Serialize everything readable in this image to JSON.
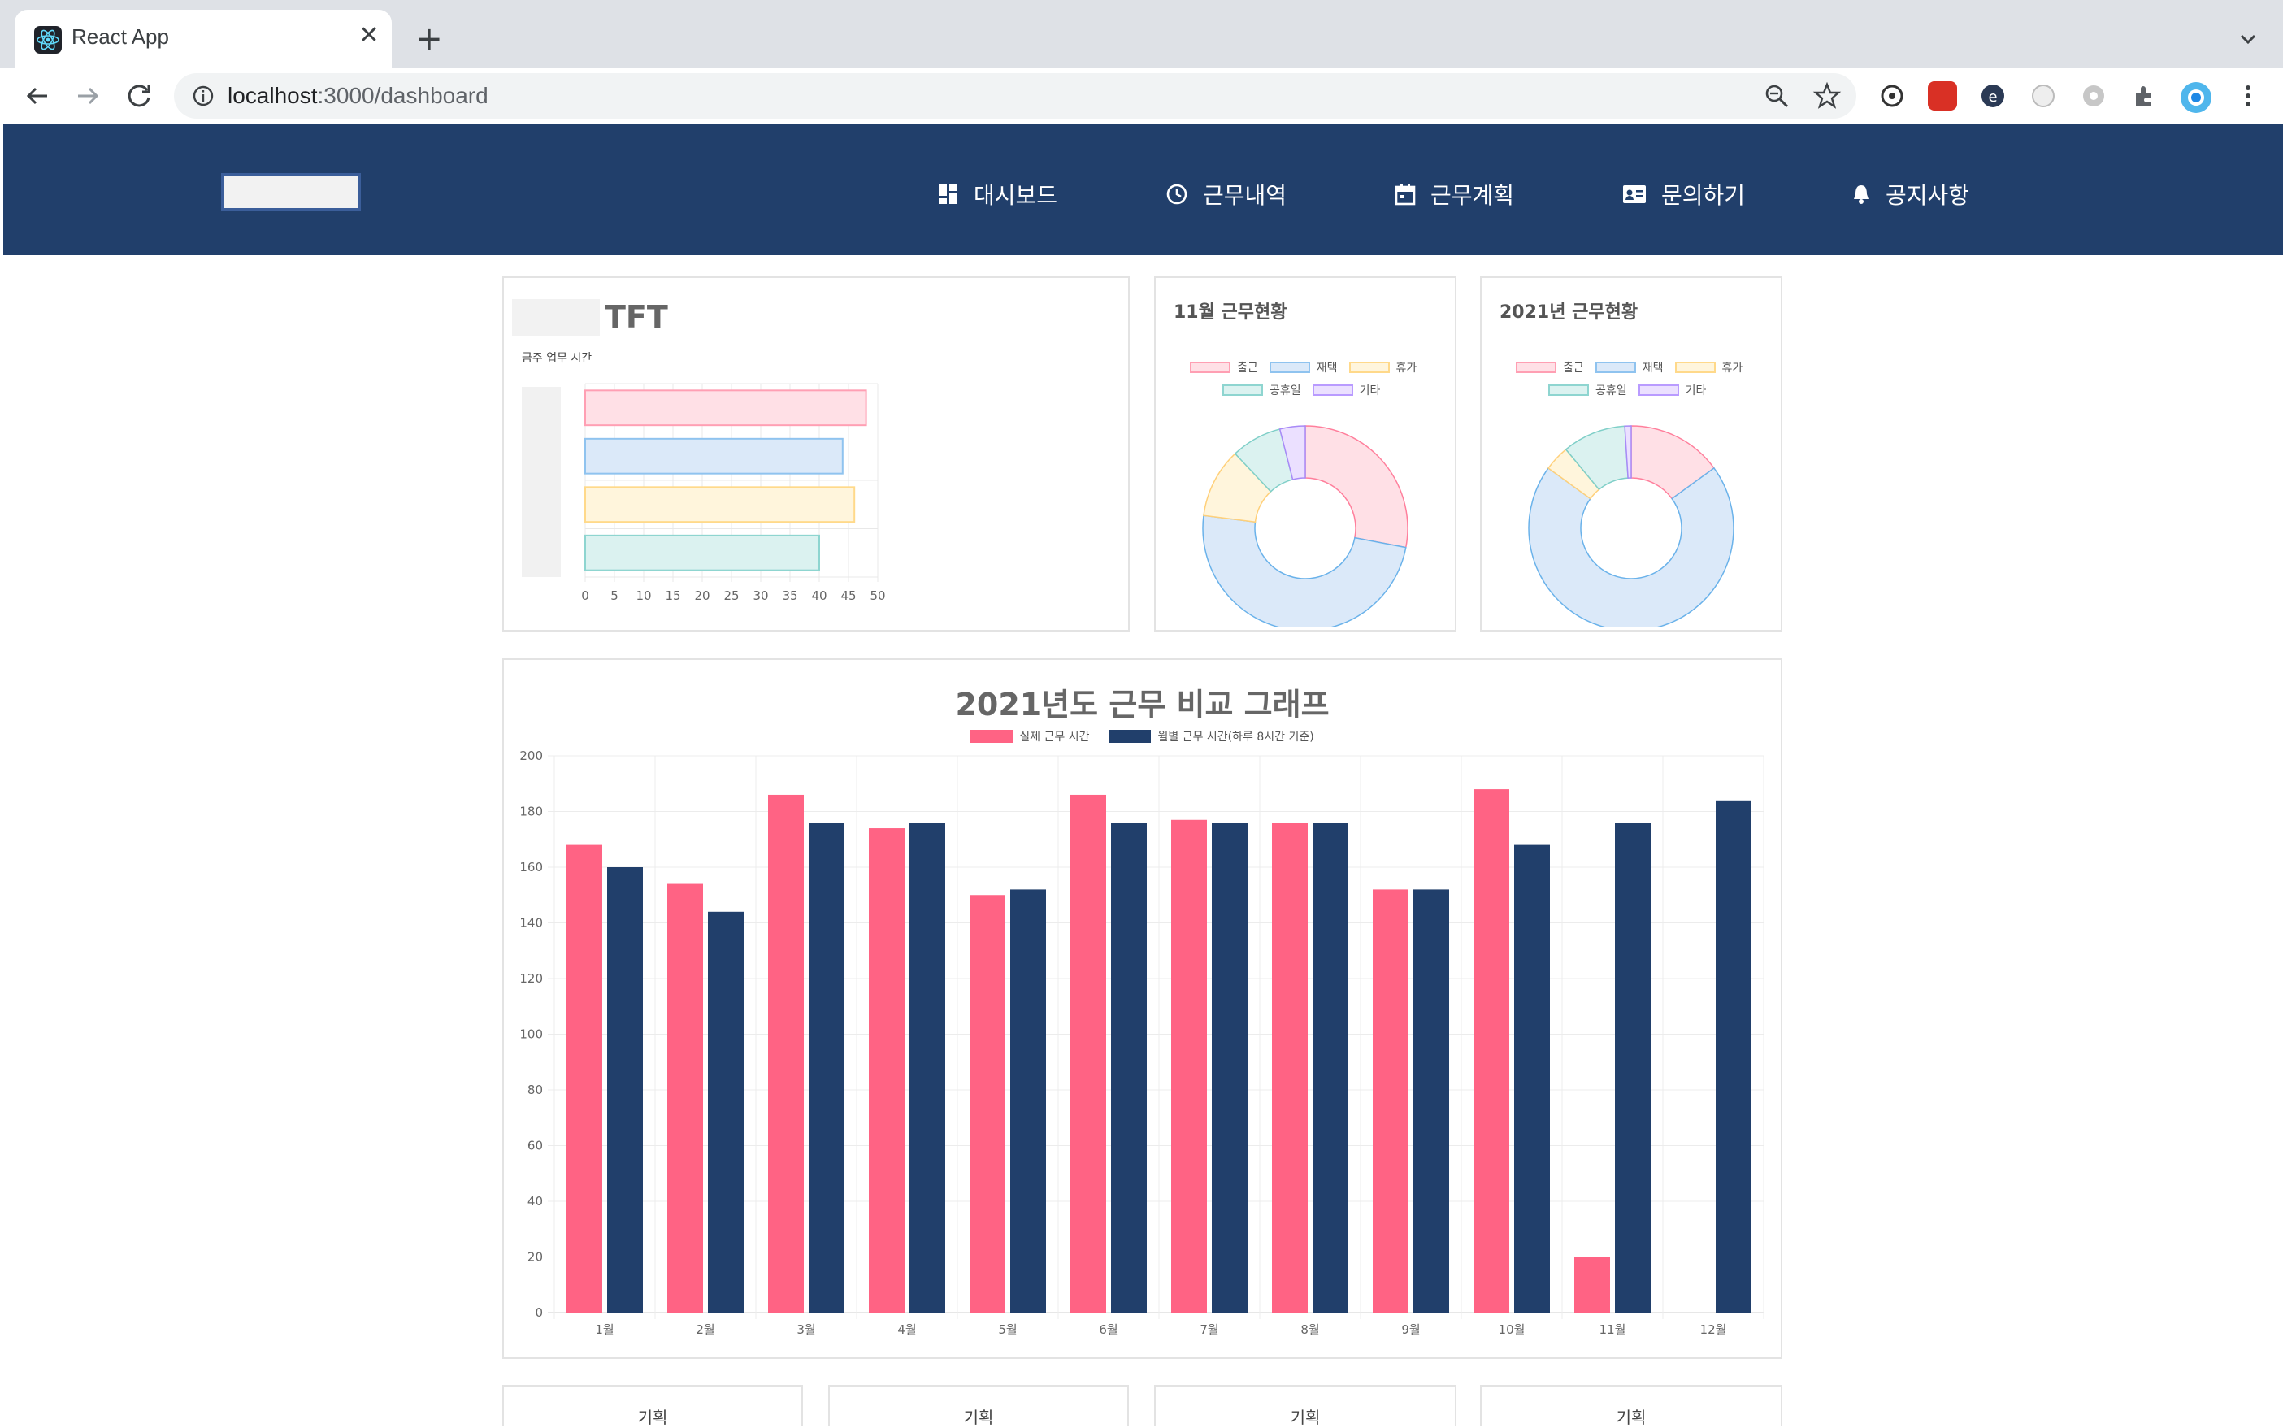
{
  "browser": {
    "tab_title": "React App",
    "url_host": "localhost",
    "url_path": ":3000/dashboard"
  },
  "nav": {
    "items": [
      {
        "label": "대시보드",
        "icon": "dashboard-icon"
      },
      {
        "label": "근무내역",
        "icon": "clock-icon"
      },
      {
        "label": "근무계획",
        "icon": "calendar-icon"
      },
      {
        "label": "문의하기",
        "icon": "contact-card-icon"
      },
      {
        "label": "공지사항",
        "icon": "bell-icon"
      }
    ]
  },
  "week_card": {
    "title": "TFT",
    "subtitle": "금주 업무 시간"
  },
  "month_card": {
    "title": "11월 근무현황"
  },
  "year_card": {
    "title": "2021년 근무현황"
  },
  "legend_labels": [
    "출근",
    "재택",
    "휴가",
    "공휴일",
    "기타"
  ],
  "colors": {
    "nav_bg": "#213f6b",
    "pink": "#ff6384",
    "navy": "#213f6b",
    "pink_light": "#ffe0e6",
    "blue_light": "#dbe9f9",
    "yellow_light": "#fff5dc",
    "teal_light": "#dbf2f0",
    "purple_light": "#ebe0ff"
  },
  "compare_card": {
    "title": "2021년도 근무 비교 그래프"
  },
  "bottom_cards": [
    "기획",
    "기획",
    "기획",
    "기획"
  ],
  "chart_data": [
    {
      "type": "bar",
      "orientation": "horizontal",
      "subtitle": "금주 업무 시간",
      "values": [
        48,
        44,
        46,
        40
      ],
      "series_colors": [
        "pink",
        "blue",
        "yellow",
        "teal"
      ],
      "xlim": [
        0,
        50
      ],
      "xticks": [
        0,
        5,
        10,
        15,
        20,
        25,
        30,
        35,
        40,
        45,
        50
      ]
    },
    {
      "type": "pie",
      "title": "11월 근무현황",
      "labels": [
        "출근",
        "재택",
        "휴가",
        "공휴일",
        "기타"
      ],
      "values": [
        28,
        49,
        11,
        8,
        4
      ]
    },
    {
      "type": "pie",
      "title": "2021년 근무현황",
      "labels": [
        "출근",
        "재택",
        "휴가",
        "공휴일",
        "기타"
      ],
      "values": [
        15,
        70,
        4,
        10,
        1
      ]
    },
    {
      "type": "bar",
      "title": "2021년도 근무 비교 그래프",
      "categories": [
        "1월",
        "2월",
        "3월",
        "4월",
        "5월",
        "6월",
        "7월",
        "8월",
        "9월",
        "10월",
        "11월",
        "12월"
      ],
      "series": [
        {
          "name": "실제 근무 시간",
          "color": "#ff6384",
          "values": [
            168,
            154,
            186,
            174,
            150,
            186,
            177,
            176,
            152,
            188,
            20,
            null
          ]
        },
        {
          "name": "월별 근무 시간(하루 8시간 기준)",
          "color": "#213f6b",
          "values": [
            160,
            144,
            176,
            176,
            152,
            176,
            176,
            176,
            152,
            168,
            176,
            184
          ]
        }
      ],
      "ylim": [
        0,
        200
      ],
      "yticks": [
        0,
        20,
        40,
        60,
        80,
        100,
        120,
        140,
        160,
        180,
        200
      ]
    }
  ]
}
